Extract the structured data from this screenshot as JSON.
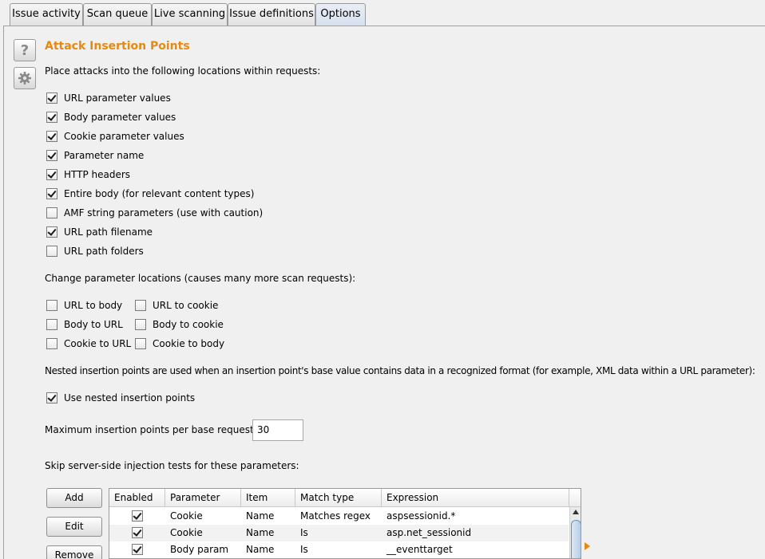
{
  "tabs": [
    {
      "label": "Issue activity",
      "active": false
    },
    {
      "label": "Scan queue",
      "active": false
    },
    {
      "label": "Live scanning",
      "active": false
    },
    {
      "label": "Issue definitions",
      "active": false
    },
    {
      "label": "Options",
      "active": true
    }
  ],
  "side_icons": {
    "help": "?",
    "settings": "gear-icon"
  },
  "section": {
    "title": "Attack Insertion Points",
    "intro": "Place attacks into the following locations within requests:",
    "locations": [
      {
        "label": "URL parameter values",
        "checked": true
      },
      {
        "label": "Body parameter values",
        "checked": true
      },
      {
        "label": "Cookie parameter values",
        "checked": true
      },
      {
        "label": "Parameter name",
        "checked": true
      },
      {
        "label": "HTTP headers",
        "checked": true
      },
      {
        "label": "Entire body (for relevant content types)",
        "checked": true
      },
      {
        "label": "AMF string parameters (use with caution)",
        "checked": false
      },
      {
        "label": "URL path filename",
        "checked": true
      },
      {
        "label": "URL path folders",
        "checked": false
      }
    ],
    "change_intro": "Change parameter locations (causes many more scan requests):",
    "change_locations": [
      {
        "label": "URL to body",
        "checked": false
      },
      {
        "label": "URL to cookie",
        "checked": false
      },
      {
        "label": "Body to URL",
        "checked": false
      },
      {
        "label": "Body to cookie",
        "checked": false
      },
      {
        "label": "Cookie to URL",
        "checked": false
      },
      {
        "label": "Cookie to body",
        "checked": false
      }
    ],
    "nested_intro": "Nested insertion points are used when an insertion point's base value contains data in a recognized format (for example, XML data within a URL parameter):",
    "nested": {
      "label": "Use nested insertion points",
      "checked": true
    },
    "max_label": "Maximum insertion points per base request:",
    "max_value": "30",
    "skip_intro": "Skip server-side injection tests for these parameters:",
    "buttons": {
      "add": "Add",
      "edit": "Edit",
      "remove": "Remove"
    },
    "table": {
      "columns": [
        "Enabled",
        "Parameter",
        "Item",
        "Match type",
        "Expression"
      ],
      "rows": [
        {
          "enabled": true,
          "parameter": "Cookie",
          "item": "Name",
          "match_type": "Matches regex",
          "expression": "aspsessionid.*"
        },
        {
          "enabled": true,
          "parameter": "Cookie",
          "item": "Name",
          "match_type": "Is",
          "expression": "asp.net_sessionid"
        },
        {
          "enabled": true,
          "parameter": "Body param",
          "item": "Name",
          "match_type": "Is",
          "expression": "__eventtarget"
        }
      ]
    }
  },
  "colors": {
    "title": "#e58a10",
    "background": "#f0f0f0"
  }
}
